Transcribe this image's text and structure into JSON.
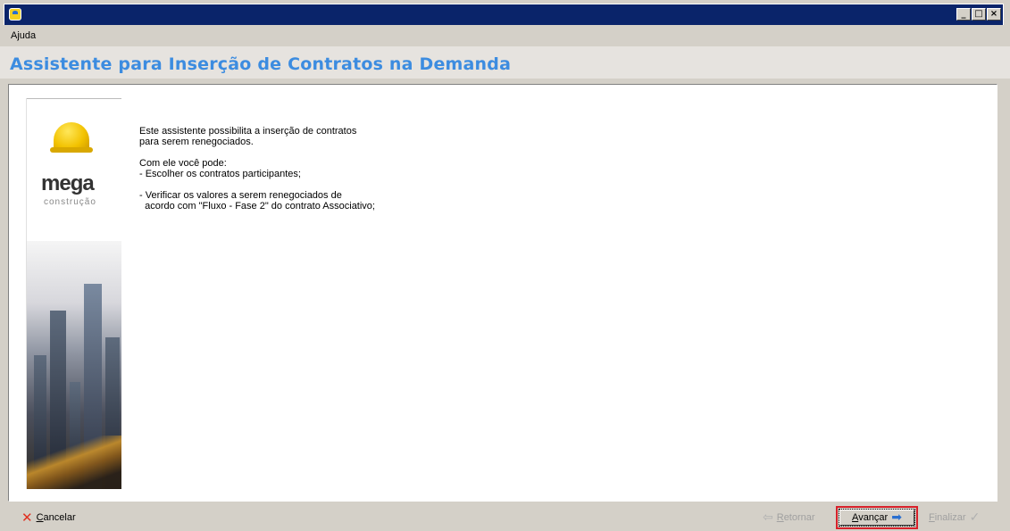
{
  "window": {
    "controls": {
      "minimize": "_",
      "maximize": "□",
      "close": "×"
    }
  },
  "menu": {
    "help": "Ajuda"
  },
  "wizard": {
    "title": "Assistente para Inserção de Contratos na Demanda"
  },
  "banner": {
    "logo": "mega",
    "logo_sub": "construção"
  },
  "content": {
    "lines": [
      "Este assistente possibilita a inserção de contratos",
      "para serem renegociados.",
      "",
      "Com ele você pode:",
      "- Escolher os contratos participantes;",
      "",
      "- Verificar os valores a serem renegociados de",
      "  acordo com \"Fluxo - Fase 2\" do contrato Associativo;"
    ]
  },
  "buttons": {
    "cancel": {
      "label": "Cancelar",
      "accel": "C",
      "rest": "ancelar",
      "icon": "close-x-icon"
    },
    "back": {
      "label": "Retornar",
      "accel": "R",
      "rest": "etornar",
      "icon": "arrow-left-icon",
      "enabled": false
    },
    "next": {
      "label": "Avançar",
      "accel": "A",
      "rest": "vançar",
      "icon": "arrow-right-icon",
      "enabled": true,
      "focused": true
    },
    "finish": {
      "label": "Finalizar",
      "accel": "F",
      "rest": "inalizar",
      "icon": "checkmark-icon",
      "enabled": false
    }
  },
  "colors": {
    "title": "#3c8ce0",
    "titlebar": "#0a246a",
    "focus_highlight": "#d8202a"
  }
}
